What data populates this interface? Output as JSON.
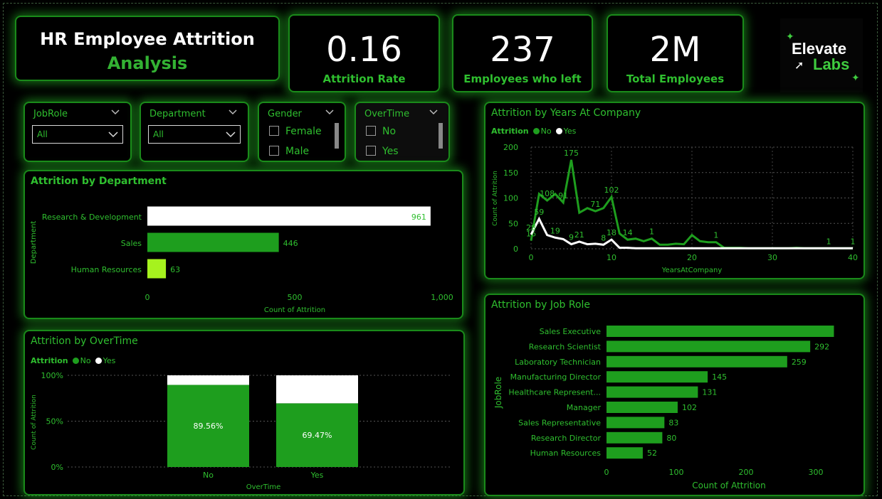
{
  "header": {
    "title_line1": "HR Employee Attrition",
    "title_line2": "Analysis"
  },
  "kpis": [
    {
      "value": "0.16",
      "label": "Attrition Rate"
    },
    {
      "value": "237",
      "label": "Employees who left"
    },
    {
      "value": "2M",
      "label": "Total Employees"
    }
  ],
  "logo": {
    "line1": "Elevate",
    "line2": "Labs"
  },
  "slicers": {
    "jobrole": {
      "header": "JobRole",
      "value": "All"
    },
    "department": {
      "header": "Department",
      "value": "All"
    },
    "gender": {
      "header": "Gender",
      "options": [
        "Female",
        "Male"
      ]
    },
    "overtime": {
      "header": "OverTime",
      "options": [
        "No",
        "Yes"
      ]
    }
  },
  "legend": {
    "title": "Attrition",
    "no": "No",
    "yes": "Yes"
  },
  "colors": {
    "accent": "#1e9e1e",
    "yes": "#ffffff",
    "hr_bar": "#a6f21e",
    "text": "#2fbf2f"
  },
  "chart_data": [
    {
      "id": "dept",
      "type": "bar",
      "orientation": "horizontal",
      "title": "Attrition by Department",
      "xlabel": "Count of Attrition",
      "ylabel": "Department",
      "categories": [
        "Research & Development",
        "Sales",
        "Human Resources"
      ],
      "values": [
        961,
        446,
        63
      ],
      "bar_colors": [
        "#ffffff",
        "#1e9e1e",
        "#a6f21e"
      ],
      "xlim": [
        0,
        1000
      ],
      "xticks": [
        "0",
        "500",
        "1,000"
      ]
    },
    {
      "id": "overtime",
      "type": "bar",
      "stacked": "100%",
      "title": "Attrition by OverTime",
      "xlabel": "OverTime",
      "ylabel": "Count of Attrition",
      "categories": [
        "No",
        "Yes"
      ],
      "series": [
        {
          "name": "No",
          "values": [
            89.56,
            69.47
          ],
          "labels": [
            "89.56%",
            "69.47%"
          ]
        },
        {
          "name": "Yes",
          "values": [
            10.44,
            30.53
          ]
        }
      ],
      "yticks": [
        "100%",
        "50%",
        "0%"
      ]
    },
    {
      "id": "years",
      "type": "line",
      "title": "Attrition by Years At Company",
      "xlabel": "YearsAtCompany",
      "ylabel": "Count of Attrition",
      "xlim": [
        0,
        40
      ],
      "ylim": [
        0,
        200
      ],
      "xticks": [
        "0",
        "10",
        "20",
        "30",
        "40"
      ],
      "yticks": [
        "200",
        "150",
        "100",
        "50",
        "0"
      ],
      "x": [
        0,
        1,
        2,
        3,
        4,
        5,
        6,
        7,
        8,
        9,
        10,
        11,
        12,
        13,
        14,
        15,
        16,
        17,
        18,
        19,
        20,
        21,
        22,
        23,
        24,
        25,
        26,
        27,
        28,
        29,
        30,
        31,
        32,
        33,
        34,
        35,
        36,
        37,
        38,
        39,
        40
      ],
      "series": [
        {
          "name": "No",
          "values": [
            16,
            108,
            95,
            108,
            91,
            175,
            71,
            80,
            74,
            80,
            102,
            30,
            18,
            20,
            15,
            20,
            8,
            8,
            10,
            9,
            27,
            15,
            13,
            13,
            2,
            2,
            2,
            1,
            1,
            1,
            1,
            1,
            1,
            2,
            1,
            1,
            1,
            1,
            1,
            1,
            1
          ],
          "labels": [
            {
              "x": 0,
              "text": "16"
            },
            {
              "x": 2,
              "text": "108"
            },
            {
              "x": 4,
              "text": "91"
            },
            {
              "x": 5,
              "text": "175"
            },
            {
              "x": 8,
              "text": "71"
            },
            {
              "x": 10,
              "text": "102"
            },
            {
              "x": 12,
              "text": "14"
            },
            {
              "x": 15,
              "text": "1"
            },
            {
              "x": 23,
              "text": "1"
            },
            {
              "x": 37,
              "text": "1"
            },
            {
              "x": 40,
              "text": "1"
            }
          ]
        },
        {
          "name": "Yes",
          "values": [
            28,
            59,
            27,
            22,
            19,
            9,
            14,
            9,
            10,
            8,
            18,
            2,
            2,
            1,
            1,
            1,
            1,
            1,
            1,
            1,
            1,
            1,
            1,
            1,
            1,
            1,
            1,
            1,
            1,
            1,
            1,
            1,
            1,
            1,
            1,
            1,
            1,
            1,
            1,
            1,
            1
          ],
          "labels": [
            {
              "x": 0,
              "text": "28"
            },
            {
              "x": 1,
              "text": "59"
            },
            {
              "x": 3,
              "text": "19"
            },
            {
              "x": 5,
              "text": "9"
            },
            {
              "x": 6,
              "text": "21"
            },
            {
              "x": 9,
              "text": "8"
            },
            {
              "x": 10,
              "text": "18"
            }
          ]
        }
      ]
    },
    {
      "id": "jobrole",
      "type": "bar",
      "orientation": "horizontal",
      "title": "Attrition by Job Role",
      "xlabel": "Count of Attrition",
      "ylabel": "JobRole",
      "categories": [
        "Sales Executive",
        "Research Scientist",
        "Laboratory Technician",
        "Manufacturing Director",
        "Healthcare Represent...",
        "Manager",
        "Sales Representative",
        "Research Director",
        "Human Resources"
      ],
      "values": [
        326,
        292,
        259,
        145,
        131,
        102,
        83,
        80,
        52
      ],
      "data_labels": [
        "",
        "292",
        "259",
        "145",
        "131",
        "102",
        "83",
        "80",
        "52"
      ],
      "xlim": [
        0,
        350
      ],
      "xticks": [
        "0",
        "100",
        "200",
        "300"
      ]
    }
  ]
}
